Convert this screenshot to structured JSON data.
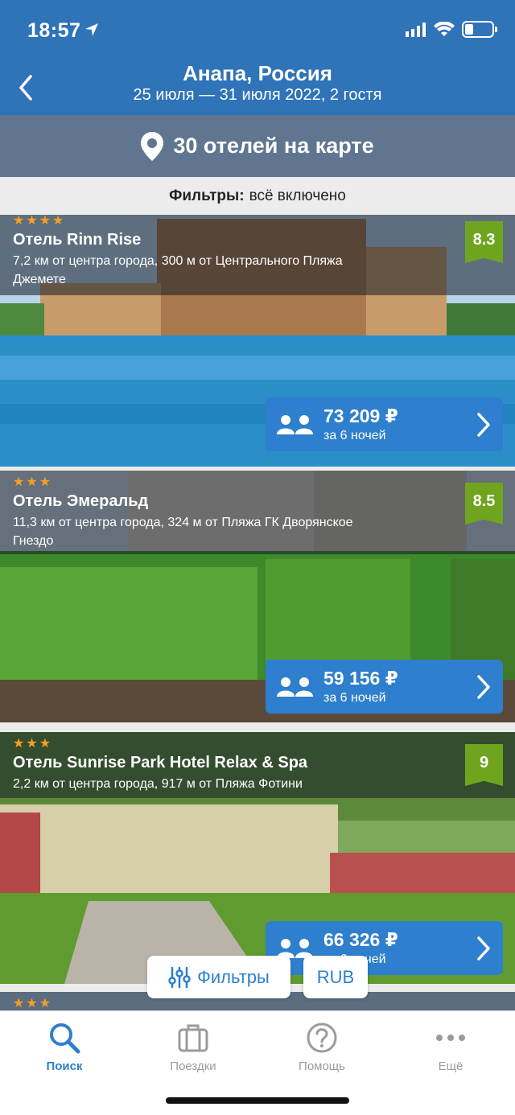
{
  "status": {
    "time": "18:57"
  },
  "header": {
    "title": "Анапа, Россия",
    "subtitle": "25 июля — 31 июля 2022, 2 гостя"
  },
  "map_bar": {
    "label": "30 отелей на карте"
  },
  "filter_bar": {
    "label": "Фильтры:",
    "value": "всё включено"
  },
  "hotels": [
    {
      "stars": "★★★★",
      "name": "Отель Rinn Rise",
      "distance": "7,2 км от центра города, 300 м от Центрального Пляжа Джемете",
      "rating": "8.3",
      "price": "73 209 ₽",
      "per": "за 6 ночей"
    },
    {
      "stars": "★★★",
      "name": "Отель Эмеральд",
      "distance": "11,3 км от центра города, 324 м от Пляжа ГК Дворянское Гнездо",
      "rating": "8.5",
      "price": "59 156 ₽",
      "per": "за 6 ночей"
    },
    {
      "stars": "★★★",
      "name": "Отель Sunrise Park Hotel Relax & Spa",
      "distance": "2,2 км от центра города, 917 м от Пляжа Фотини",
      "rating": "9",
      "price": "66 326 ₽",
      "per": "за 6 ночей"
    },
    {
      "stars": "★★★"
    }
  ],
  "floating": {
    "filters_label": "Фильтры",
    "currency_label": "RUB"
  },
  "tabs": [
    {
      "label": "Поиск",
      "icon": "search-icon",
      "active": true
    },
    {
      "label": "Поездки",
      "icon": "suitcase-icon",
      "active": false
    },
    {
      "label": "Помощь",
      "icon": "help-icon",
      "active": false
    },
    {
      "label": "Ещё",
      "icon": "more-icon",
      "active": false
    }
  ],
  "colors": {
    "header": "#2f73b9",
    "map_bar": "#5f7590",
    "accent": "#2e7fcd",
    "rating": "#6fa51e",
    "stars": "#f4a024"
  }
}
